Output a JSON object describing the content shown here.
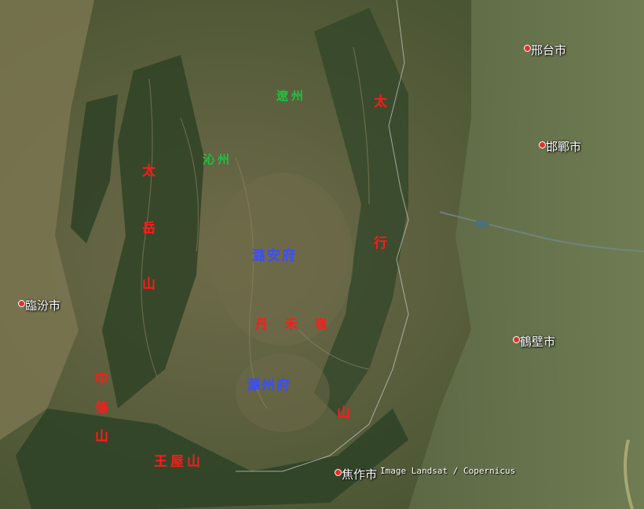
{
  "map": {
    "attribution": "Image Landsat / Copernicus",
    "cities": [
      "邢台市",
      "邯鄲市",
      "臨汾市",
      "鶴壁市",
      "焦作市"
    ],
    "mountains_red": {
      "taiyue": [
        "太",
        "岳",
        "山"
      ],
      "taihang": [
        "太",
        "行",
        "山"
      ],
      "zhongtiao": [
        "中",
        "條",
        "山"
      ],
      "wangwu": "王屋山",
      "danhe": "丹 禾 嶺"
    },
    "regions_green": [
      "遼州",
      "沁州"
    ],
    "prefectures_blue": [
      "潞安府",
      "澤州府"
    ],
    "colors": {
      "mountain_label": "#ff1a1a",
      "region_label": "#20c040",
      "prefecture_label": "#3b4dff",
      "city_pin": "#e0322c"
    }
  }
}
